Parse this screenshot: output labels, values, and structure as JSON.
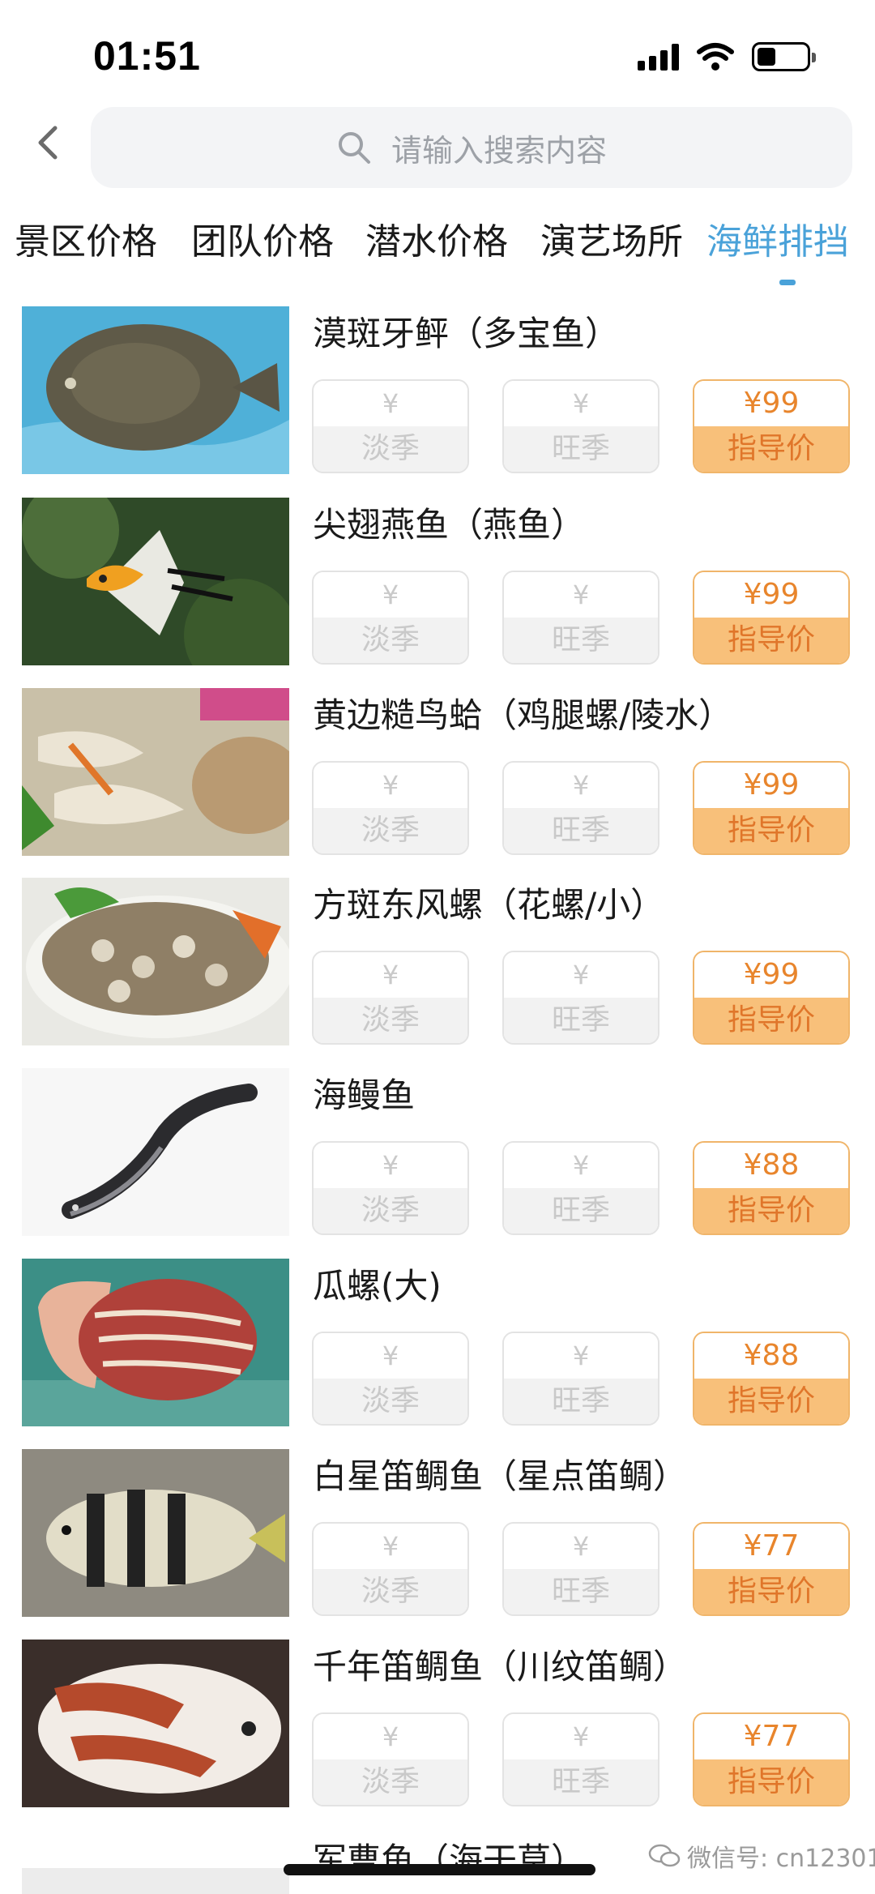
{
  "status_bar": {
    "time": "01:51"
  },
  "search": {
    "placeholder": "请输入搜索内容"
  },
  "tabs": [
    {
      "label": "景区价格",
      "active": false
    },
    {
      "label": "团队价格",
      "active": false
    },
    {
      "label": "潜水价格",
      "active": false
    },
    {
      "label": "演艺场所",
      "active": false
    },
    {
      "label": "海鲜排挡",
      "active": true
    }
  ],
  "price_labels": {
    "currency": "¥",
    "off_season": "淡季",
    "peak_season": "旺季",
    "guide_price": "指导价"
  },
  "items": [
    {
      "name": "漠斑牙鲆（多宝鱼）",
      "guide_price": "¥99",
      "icon": "flatfish-image"
    },
    {
      "name": "尖翅燕鱼（燕鱼）",
      "guide_price": "¥99",
      "icon": "angelfish-image"
    },
    {
      "name": "黄边糙鸟蛤（鸡腿螺/陵水）",
      "guide_price": "¥99",
      "icon": "cockle-image"
    },
    {
      "name": "方斑东风螺（花螺/小）",
      "guide_price": "¥99",
      "icon": "babylon-snail-image"
    },
    {
      "name": "海鳗鱼",
      "guide_price": "¥88",
      "icon": "eel-image"
    },
    {
      "name": "瓜螺(大)",
      "guide_price": "¥88",
      "icon": "melon-shell-image"
    },
    {
      "name": "白星笛鲷鱼（星点笛鲷）",
      "guide_price": "¥77",
      "icon": "striped-snapper-image"
    },
    {
      "name": "千年笛鲷鱼（川纹笛鲷）",
      "guide_price": "¥77",
      "icon": "emperor-snapper-image"
    }
  ],
  "partial_item": {
    "name": "军曹鱼（海干草）"
  },
  "watermark": {
    "text": "微信号: cn12301"
  },
  "colors": {
    "accent": "#4aa2d9",
    "guide_border": "#f0b56a",
    "guide_fill": "#f8c07a",
    "guide_text": "#e8852c"
  }
}
